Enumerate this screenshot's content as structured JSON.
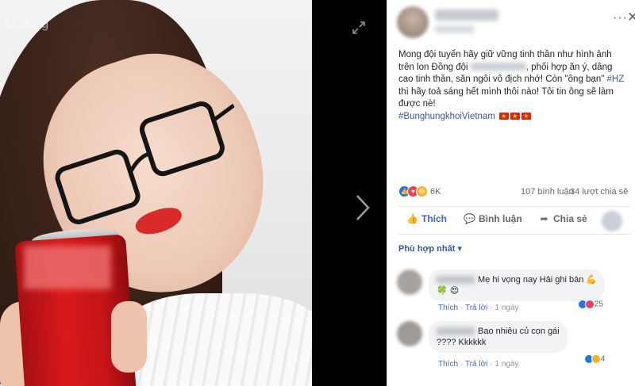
{
  "photo": {
    "tag_label": "tự động"
  },
  "post": {
    "body_part1": "Mong đội tuyển hãy giữ vững tinh thần như hình ảnh trên lon Đồng đội ",
    "body_part2": ", phối hợp ăn ý, dâng cao tinh thần, săn ngôi vô địch nhớ! Còn \"ông bạn\" ",
    "inline_hashtag": "#HZ",
    "body_part3": " thì hãy toả sáng hết mình thôi nào! Tôi tin ông sẽ làm được nè!",
    "hashtag": "#BunghungkhoiVietnam",
    "reaction_count": "6K",
    "comment_count": "107 bình luận",
    "share_count": "34 lượt chia sẻ",
    "actions": {
      "like": "Thích",
      "comment": "Bình luận",
      "share": "Chia sẻ"
    },
    "sort_label": "Phù hợp nhất ▾"
  },
  "comments": [
    {
      "text": "Mẹ hi vọng nay Hải ghi bàn 💪",
      "emoji_line": "🍀 😍",
      "like_label": "Thích",
      "reply_label": "Trả lời",
      "time": "1 ngày",
      "reaction_count": "25"
    },
    {
      "text": "Bao nhiêu củ con gái",
      "text2": "???? Kkkkkk",
      "like_label": "Thích",
      "reply_label": "Trả lời",
      "time": "1 ngày",
      "reaction_count": "4"
    }
  ],
  "colors": {
    "link_blue": "#365899",
    "like_blue": "#4267b2",
    "flag_red": "#da251d"
  },
  "icons": [
    "expand-icon",
    "next-arrow-icon",
    "more-icon",
    "close-icon",
    "thumb-up-icon",
    "comment-icon",
    "share-icon"
  ]
}
